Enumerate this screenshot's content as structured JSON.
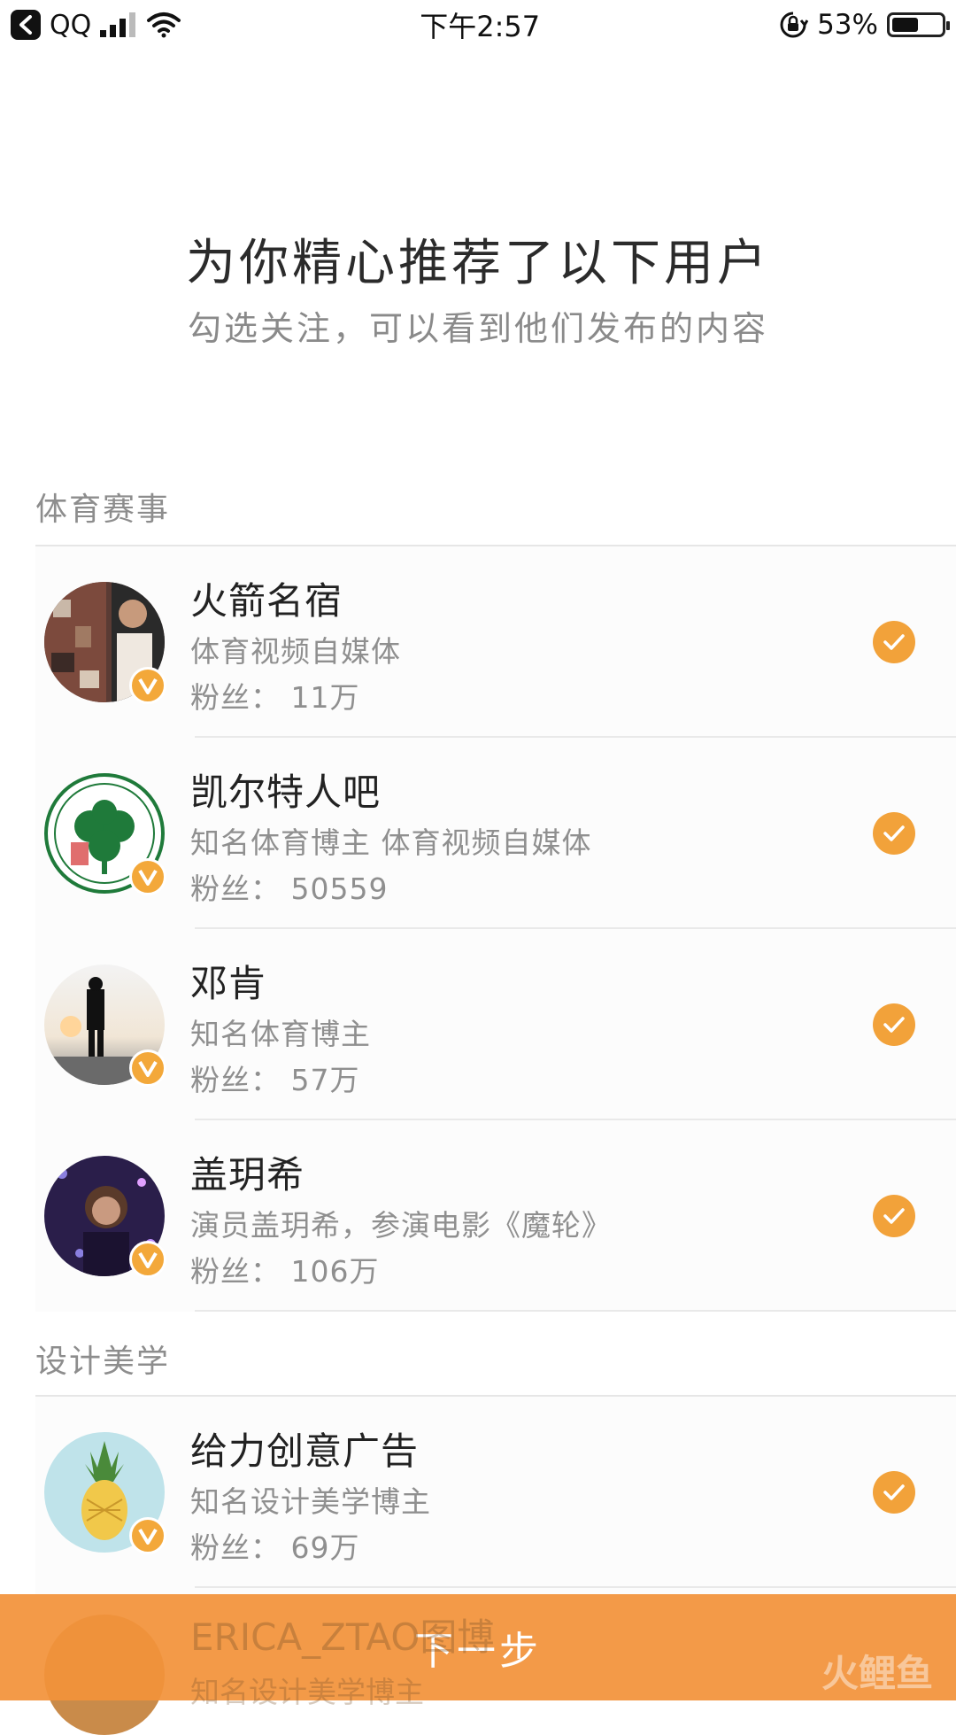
{
  "status_bar": {
    "app": "QQ",
    "time": "下午2:57",
    "battery": "53%",
    "battery_level": 0.53
  },
  "header": {
    "title": "为你精心推荐了以下用户",
    "subtitle": "勾选关注，可以看到他们发布的内容"
  },
  "sections": [
    {
      "title": "体育赛事",
      "users": [
        {
          "name": "火箭名宿",
          "desc": "体育视频自媒体",
          "fans": "粉丝：  11万",
          "checked": true
        },
        {
          "name": "凯尔特人吧",
          "desc": "知名体育博主 体育视频自媒体",
          "fans": "粉丝：  50559",
          "checked": true
        },
        {
          "name": "邓肯",
          "desc": "知名体育博主",
          "fans": "粉丝：  57万",
          "checked": true
        },
        {
          "name": "盖玥希",
          "desc": "演员盖玥希，参演电影《魔轮》",
          "fans": "粉丝：  106万",
          "checked": true
        }
      ]
    },
    {
      "title": "设计美学",
      "users": [
        {
          "name": "给力创意广告",
          "desc": "知名设计美学博主",
          "fans": "粉丝：  69万",
          "checked": true
        },
        {
          "name": "ERICA_ZTAO图博",
          "desc": "知名设计美学博主",
          "fans": "",
          "checked": true
        }
      ]
    }
  ],
  "footer": {
    "next_label": "下一步",
    "watermark": "火鲤鱼"
  },
  "colors": {
    "accent": "#f2a23a",
    "verified": "#f3a83a",
    "next_bar": "#f2923a"
  }
}
